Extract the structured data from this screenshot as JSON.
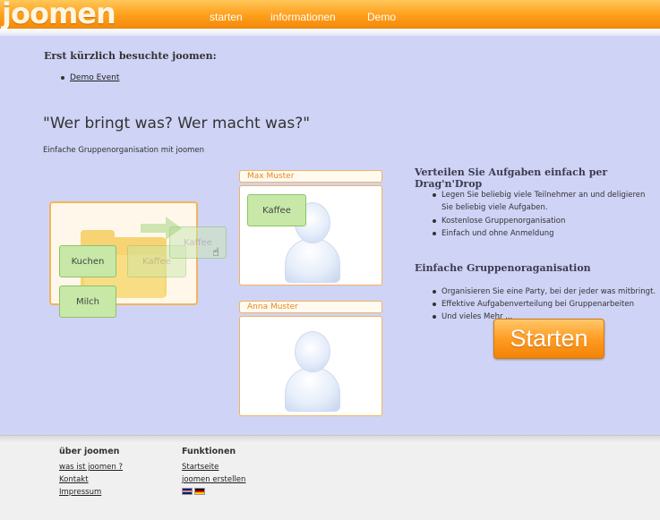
{
  "header": {
    "logo": "joomen",
    "nav": [
      "starten",
      "informationen",
      "Demo"
    ]
  },
  "recent": {
    "heading": "Erst kürzlich besuchte joomen:",
    "items": [
      "Demo Event"
    ]
  },
  "hero": {
    "title": "\"Wer bringt was? Wer macht was?\"",
    "subtitle": "Einfache Gruppenorganisation mit joomen"
  },
  "demo": {
    "items": [
      "Kuchen",
      "Kaffee",
      "Milch"
    ],
    "dragging": "Kaffee",
    "people": [
      {
        "name": "Max Muster",
        "items": [
          "Kaffee"
        ]
      },
      {
        "name": "Anna Muster",
        "items": []
      }
    ]
  },
  "features": {
    "title1": "Verteilen Sie Aufgaben einfach per Drag'n'Drop",
    "list1": [
      "Legen Sie beliebig viele Teilnehmer an und deligieren",
      "Sie beliebig viele Aufgaben.",
      "Kostenlose Gruppenorganisation",
      "Einfach und ohne Anmeldung"
    ],
    "title2": "Einfache Gruppenoraganisation",
    "list2": [
      "Organisieren Sie eine Party, bei der jeder was mitbringt.",
      "Effektive Aufgabenverteilung bei Gruppenarbeiten",
      "Und vieles Mehr ..."
    ]
  },
  "cta": {
    "label": "Starten"
  },
  "footer": {
    "col1": {
      "heading": "über joomen",
      "links": [
        "was ist joomen ?",
        "Kontakt",
        "Impressum"
      ]
    },
    "col2": {
      "heading": "Funktionen",
      "links": [
        "Startseite",
        "joomen erstellen"
      ]
    }
  },
  "colors": {
    "accent": "#ff9f1a",
    "background": "#cfd3f5",
    "item_green": "#c7e8a7"
  }
}
